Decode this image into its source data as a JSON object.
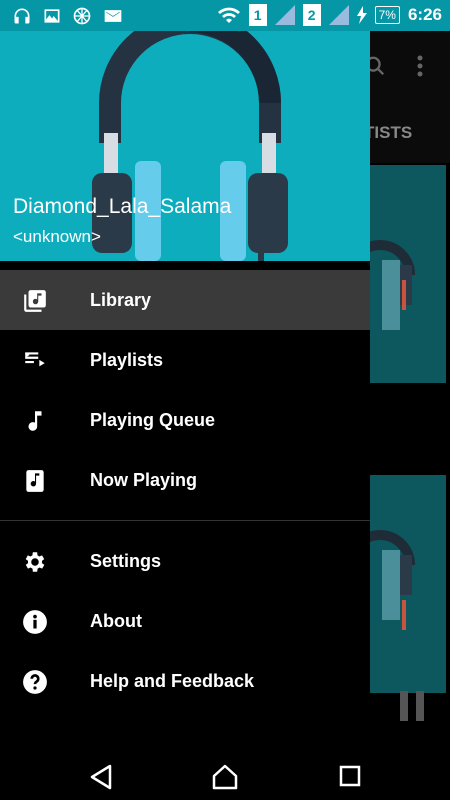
{
  "status_bar": {
    "sim1": "1",
    "sim2": "2",
    "battery": "7%",
    "time": "6:26"
  },
  "background_app": {
    "tab_label": "TISTS"
  },
  "drawer": {
    "song_title": "Diamond_Lala_Salama",
    "song_artist": "<unknown>",
    "items": [
      {
        "label": "Library",
        "icon": "library-music-icon",
        "active": true
      },
      {
        "label": "Playlists",
        "icon": "playlist-icon",
        "active": false
      },
      {
        "label": "Playing Queue",
        "icon": "music-note-icon",
        "active": false
      },
      {
        "label": "Now Playing",
        "icon": "now-playing-icon",
        "active": false
      }
    ],
    "secondary_items": [
      {
        "label": "Settings",
        "icon": "gear-icon"
      },
      {
        "label": "About",
        "icon": "info-icon"
      },
      {
        "label": "Help and Feedback",
        "icon": "help-icon"
      }
    ]
  },
  "colors": {
    "status_bar": "#0697a6",
    "header": "#0dadbd",
    "active_item": "#3a3a3a"
  }
}
